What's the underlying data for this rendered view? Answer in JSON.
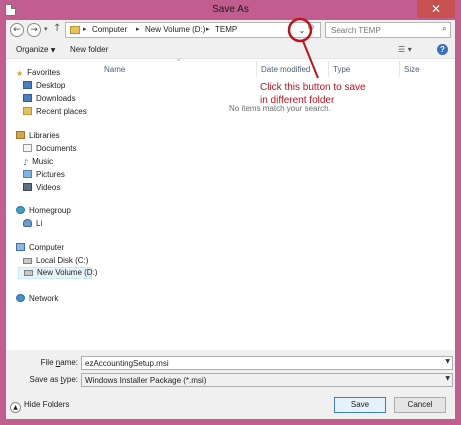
{
  "window": {
    "title": "Save As",
    "close_glyph": "✕"
  },
  "navbar": {
    "back_glyph": "←",
    "forward_glyph": "→",
    "recent_glyph": "▾",
    "up_glyph": "↑",
    "breadcrumb": [
      "Computer",
      "New Volume (D:)",
      "TEMP"
    ],
    "sep_glyph": "▸",
    "dropdown_glyph": "⌄",
    "refresh_glyph": "↻",
    "search_placeholder": "Search TEMP",
    "search_icon": "⌕"
  },
  "commandbar": {
    "organize_label": "Organize",
    "organize_arrow": "▼",
    "new_folder_label": "New folder",
    "views_glyph": "☰ ▾",
    "help_glyph": "?"
  },
  "sidebar": {
    "favorites": {
      "label": "Favorites",
      "icon": "★",
      "items": [
        "Desktop",
        "Downloads",
        "Recent places"
      ]
    },
    "libraries": {
      "label": "Libraries",
      "items": [
        "Documents",
        "Music",
        "Pictures",
        "Videos"
      ],
      "music_icon": "♪"
    },
    "homegroup": {
      "label": "Homegroup",
      "items": [
        "Li"
      ]
    },
    "computer": {
      "label": "Computer",
      "items": [
        "Local Disk (C:)",
        "New Volume (D:)"
      ]
    },
    "network": {
      "label": "Network"
    }
  },
  "filelist": {
    "columns": [
      "Name",
      "Date modified",
      "Type",
      "Size"
    ],
    "sort_glyph": "^",
    "empty_message": "No items match your search."
  },
  "annotation": {
    "line1": "Click this button to save",
    "line2": "in different folder",
    "color": "#c0111b"
  },
  "form": {
    "filename_label_u": "n",
    "filename_label_pre": "File ",
    "filename_label_post": "ame:",
    "filename_value": "ezAccountingSetup.msi",
    "filetype_label_pre": "Save as ",
    "filetype_label_u": "t",
    "filetype_label_post": "ype:",
    "filetype_value": "Windows Installer Package (*.msi)",
    "combo_arrow": "▼"
  },
  "footer": {
    "hide_folders_label": "Hide Folders",
    "hide_glyph": "▲",
    "save_label": "Save",
    "cancel_label": "Cancel"
  },
  "colors": {
    "frame": "#c25e8f",
    "close": "#c75050",
    "accent": "#3c7fb1"
  }
}
